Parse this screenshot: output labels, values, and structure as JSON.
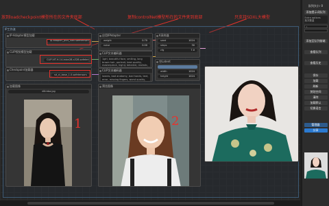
{
  "annotations": {
    "note1": "放到loadcheckpoint模型所在的文件夹底部",
    "note2": "复制controlNet模型所在的文件夹到底部",
    "note3": "只支持SDXL大模型",
    "num1": "1",
    "num2": "2"
  },
  "group": {
    "title": "IP工作流"
  },
  "nodes": {
    "loader1": {
      "title": "IP-Adapter模型加载",
      "widget": "ip-adapter_plus_sdxl.safetensors"
    },
    "loader2": {
      "title": "CLIP视觉模型加载",
      "widget": "CLIP-ViT-H-14-laion2B-s32B.safetensors"
    },
    "loader3": {
      "title": "Checkpoint加载器",
      "widget": "sd_xl_base_1.0.safetensors"
    },
    "apply": {
      "title": "应用IPAdapter",
      "w1": "weight",
      "v1": "0.70",
      "w2": "noise",
      "v2": "0.00"
    },
    "prompt_pos": {
      "title": "CLIP文本编码器",
      "text": "1girl, beautiful face, smiling, long brown hair, portrait, best quality, masterpiece, highly detailed, realistic, photo"
    },
    "prompt_neg": {
      "title": "CLIP文本编码器",
      "text": "lowres, bad anatomy, bad hands, text, error, missing fingers, worst quality, low quality"
    },
    "ksampler": {
      "title": "K采样器",
      "w1": "seed",
      "v1": "1024",
      "w2": "steps",
      "v2": "30",
      "w3": "cfg",
      "v3": "7.0"
    },
    "empty": {
      "title": "空Latent",
      "w1": "width",
      "v1": "1024",
      "w2": "height",
      "v2": "1024"
    },
    "load_image": {
      "title": "加载图像",
      "file": "dilireba.jpg"
    },
    "preview": {
      "title": "预览图像"
    },
    "save": {
      "title": "保存图像"
    }
  },
  "sidebar": {
    "title": "队列大小: 0",
    "header": "添加提示词队列",
    "extra": "Extra options",
    "batch_label": "批次数量",
    "batch_value": "1",
    "queue_front": "添加至队列前端",
    "view_queue": "查看队列",
    "view_history": "查看历史",
    "buttons": [
      "保存",
      "加载",
      "刷新",
      "剪贴空间",
      "清除",
      "加载默认",
      "切换语言"
    ],
    "manager": "管理器",
    "share": "分享"
  },
  "colors": {
    "accent": "#e8322c",
    "manager": "#2d5b8d",
    "share": "#2b7ad1"
  }
}
